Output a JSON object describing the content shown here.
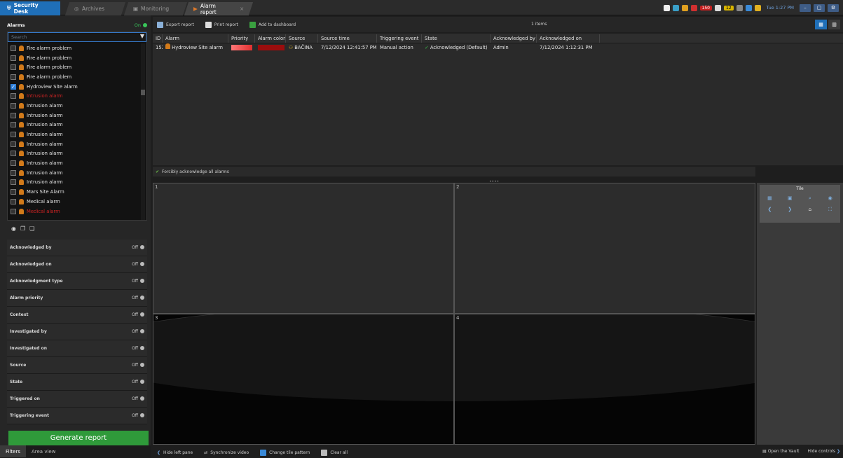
{
  "tabs": {
    "home": "Security Desk",
    "archives": "Archives",
    "monitoring": "Monitoring",
    "alarm_report": "Alarm report"
  },
  "tray": {
    "alarm_count": "150",
    "notif_count": "12",
    "clock": "Tue 1:27 PM"
  },
  "left": {
    "alarms_title": "Alarms",
    "alarms_state": "On",
    "search_placeholder": "Search",
    "alarm_items": [
      {
        "label": "Fire alarm problem",
        "checked": false,
        "red": false
      },
      {
        "label": "Fire alarm problem",
        "checked": false,
        "red": false
      },
      {
        "label": "Fire alarm problem",
        "checked": false,
        "red": false
      },
      {
        "label": "Fire alarm problem",
        "checked": false,
        "red": false
      },
      {
        "label": "Hydroview Site alarm",
        "checked": true,
        "red": false
      },
      {
        "label": "Intrusion alarm",
        "checked": false,
        "red": true
      },
      {
        "label": "Intrusion alarm",
        "checked": false,
        "red": false
      },
      {
        "label": "Intrusion alarm",
        "checked": false,
        "red": false
      },
      {
        "label": "Intrusion alarm",
        "checked": false,
        "red": false
      },
      {
        "label": "Intrusion alarm",
        "checked": false,
        "red": false
      },
      {
        "label": "Intrusion alarm",
        "checked": false,
        "red": false
      },
      {
        "label": "Intrusion alarm",
        "checked": false,
        "red": false
      },
      {
        "label": "Intrusion alarm",
        "checked": false,
        "red": false
      },
      {
        "label": "Intrusion alarm",
        "checked": false,
        "red": false
      },
      {
        "label": "Intrusion alarm",
        "checked": false,
        "red": false
      },
      {
        "label": "Mars Site Alarm",
        "checked": false,
        "red": false
      },
      {
        "label": "Medical alarm",
        "checked": false,
        "red": false
      },
      {
        "label": "Medical alarm",
        "checked": false,
        "red": true
      }
    ],
    "filters": [
      {
        "label": "Acknowledged by",
        "state": "Off"
      },
      {
        "label": "Acknowledged on",
        "state": "Off"
      },
      {
        "label": "Acknowledgment type",
        "state": "Off"
      },
      {
        "label": "Alarm priority",
        "state": "Off"
      },
      {
        "label": "Context",
        "state": "Off"
      },
      {
        "label": "Investigated by",
        "state": "Off"
      },
      {
        "label": "Investigated on",
        "state": "Off"
      },
      {
        "label": "Source",
        "state": "Off"
      },
      {
        "label": "State",
        "state": "Off"
      },
      {
        "label": "Triggered on",
        "state": "Off"
      },
      {
        "label": "Triggering event",
        "state": "Off"
      }
    ],
    "generate_label": "Generate report",
    "bottom_tabs": [
      "Filters",
      "Area view"
    ]
  },
  "toolbar": {
    "export": "Export report",
    "print": "Print report",
    "add_dashboard": "Add to dashboard",
    "items_count": "1 items"
  },
  "grid": {
    "columns": [
      "ID",
      "Alarm",
      "Priority",
      "Alarm color",
      "Source",
      "Source time",
      "Triggering event",
      "State",
      "Acknowledged by",
      "Acknowledged on"
    ],
    "rows": [
      {
        "id": "152",
        "alarm": "Hydroview Site alarm",
        "source": "BAČINA",
        "source_time": "7/12/2024 12:41:57 PM",
        "triggering_event": "Manual action",
        "state": "Acknowledged (Default)",
        "ack_by": "Admin",
        "ack_on": "7/12/2024 1:12:31 PM"
      }
    ]
  },
  "ack_bar": {
    "label": "Forcibly acknowledge all alarms",
    "handle": "••••"
  },
  "tiles": [
    "1",
    "2",
    "3",
    "4"
  ],
  "tile_controls": {
    "title": "Tile"
  },
  "bottombar": {
    "hide_left": "Hide left pane",
    "sync": "Synchronize video",
    "change_pattern": "Change tile pattern",
    "clear_all": "Clear all",
    "open_vault": "Open the Vault",
    "hide_controls": "Hide controls"
  },
  "colors": {
    "accent": "#1f6fb8",
    "generate_green": "#2f9a3a",
    "alarm_red": "#d02424",
    "on_green": "#39c65a"
  }
}
